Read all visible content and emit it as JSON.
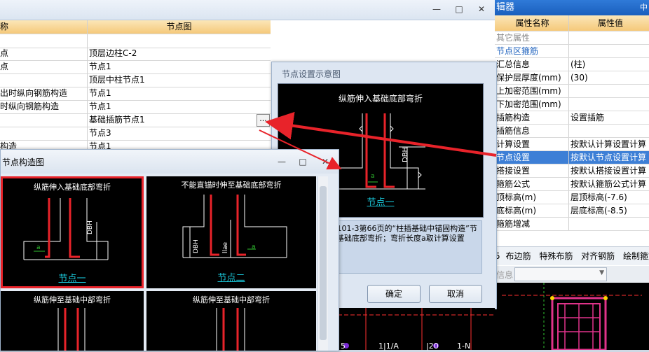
{
  "back_window": {
    "header": {
      "name_col": "称",
      "value_col": "节点图"
    },
    "rows": [
      {
        "name": "",
        "value": ""
      },
      {
        "name": "点",
        "value": "顶层边柱C-2"
      },
      {
        "name": "点",
        "value": "节点1"
      },
      {
        "name": "",
        "value": "顶层中柱节点1"
      },
      {
        "name": "出时纵向钢筋构造",
        "value": "节点1"
      },
      {
        "name": "时纵向钢筋构造",
        "value": "节点1"
      },
      {
        "name": "",
        "value": "基础插筋节点1"
      },
      {
        "name": "",
        "value": "节点3"
      },
      {
        "name": "构造",
        "value": "节点1"
      }
    ],
    "ellipsis": "..."
  },
  "property_panel": {
    "title": "辑器",
    "title_right": "中",
    "header": {
      "name": "属性名称",
      "value": "属性值"
    },
    "rows": [
      {
        "name": "其它属性",
        "value": ""
      },
      {
        "name": "节点区箍筋",
        "value": ""
      },
      {
        "name": "汇总信息",
        "value": "(柱)"
      },
      {
        "name": "保护层厚度(mm)",
        "value": "(30)"
      },
      {
        "name": "上加密范围(mm)",
        "value": ""
      },
      {
        "name": "下加密范围(mm)",
        "value": ""
      },
      {
        "name": "插筋构造",
        "value": "设置插筋"
      },
      {
        "name": "插筋信息",
        "value": ""
      },
      {
        "name": "计算设置",
        "value": "按默认计算设置计算"
      },
      {
        "name": "节点设置",
        "value": "按默认节点设置计算"
      },
      {
        "name": "搭接设置",
        "value": "按默认搭接设置计算"
      },
      {
        "name": "箍筋公式",
        "value": "按默认箍筋公式计算"
      },
      {
        "name": "顶标高(m)",
        "value": "层顶标高(-7.6)"
      },
      {
        "name": "底标高(m)",
        "value": "层底标高(-8.5)"
      },
      {
        "name": "箍筋增减",
        "value": ""
      }
    ],
    "toolbar": [
      "布边筋",
      "特殊布筋",
      "对齐钢筋",
      "绘制箍筋"
    ],
    "toolbar_prefix": "5",
    "info_label": "信息"
  },
  "preview_dialog": {
    "title": "节点设置示意图",
    "diagram_title": "纵筋伸入基础底部弯折",
    "diagram_label": "节点一",
    "dim_label": "DBH",
    "a_label": "a",
    "description": "算法：来源16G101-3第66页的“柱插基础中锚固构造”节点；柱全部纵筋基础底部弯折；弯折长度a取计算设置值。",
    "ok_label": "确定",
    "cancel_label": "取消"
  },
  "gallery_dialog": {
    "title": "节点构造图",
    "tiles": [
      {
        "title": "纵筋伸入基础底部弯折",
        "label": "节点一",
        "selected": true
      },
      {
        "title": "不能直锚时伸至基础底部弯折",
        "label": "节点二",
        "selected": false
      },
      {
        "title": "纵筋伸至基础中部弯折",
        "label": "",
        "selected": false
      },
      {
        "title": "纵筋伸至基础中部弯折",
        "label": "",
        "selected": false
      }
    ],
    "tile2_labels": {
      "dbh": "DBH",
      "lae": "llae",
      "a": "a"
    }
  },
  "bottom_cad_labels": [
    "5",
    "1|1/A",
    "|20",
    "1-N"
  ],
  "colors": {
    "accent_red": "#e8232a",
    "selection_blue": "#3d7fd6",
    "header_gold": "#f5c97a",
    "label_cyan": "#19c6d8"
  }
}
